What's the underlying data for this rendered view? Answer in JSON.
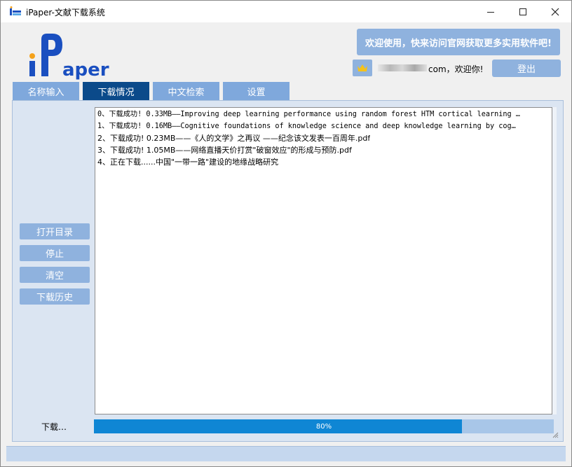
{
  "window": {
    "title": "iPaper-文献下载系统"
  },
  "logo": {
    "text": "iPaper"
  },
  "header": {
    "banner": "欢迎使用，快来访问官网获取更多实用软件吧!",
    "welcome_suffix": "com，欢迎你!",
    "logout_label": "登出"
  },
  "tabs": [
    {
      "label": "名称输入"
    },
    {
      "label": "下载情况"
    },
    {
      "label": "中文检索"
    },
    {
      "label": "设置"
    }
  ],
  "side_buttons": {
    "open_dir": "打开目录",
    "stop": "停止",
    "clear": "清空",
    "history": "下载历史"
  },
  "log_lines": [
    "0、下载成功! 0.33MB——Improving deep learning performance using random forest HTM cortical learning …",
    "1、下载成功! 0.16MB——Cognitive foundations of knowledge science and deep knowledge learning by cog…",
    "2、下载成功! 0.23MB——《人的文学》之再议 ——纪念该文发表一百周年.pdf",
    "3、下载成功! 1.05MB——网络直播天价打赏\"破窗效应\"的形成与预防.pdf",
    "4、正在下载......中国\"一带一路\"建设的地缘战略研究"
  ],
  "status": {
    "label": "下载…",
    "progress_percent": 80,
    "progress_text": "80%"
  },
  "colors": {
    "accent": "#8fb2de",
    "tab_active": "#0b4a8a",
    "progress_fill": "#0f86d4",
    "logo_blue": "#1a4fc0",
    "logo_orange": "#f5a21b"
  }
}
